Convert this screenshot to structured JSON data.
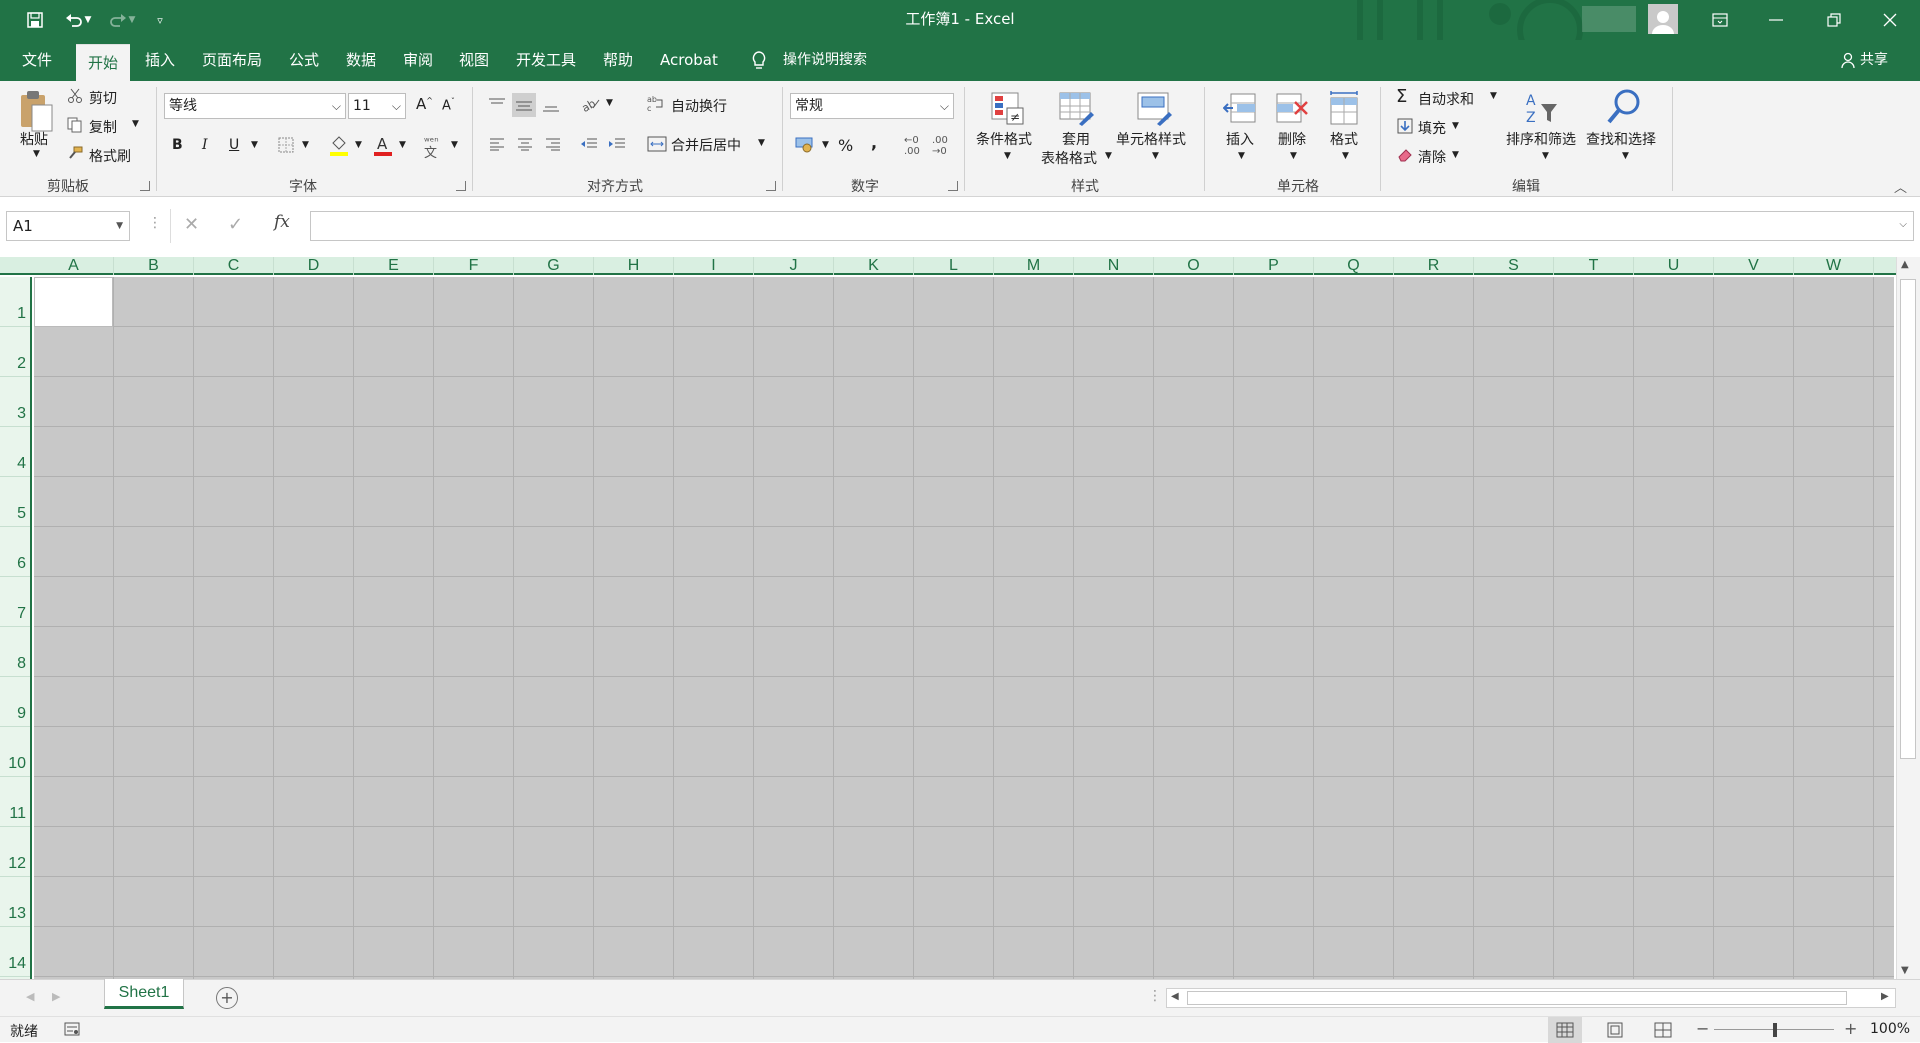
{
  "window": {
    "title": "工作簿1  -  Excel",
    "accent": "#217346"
  },
  "menu": {
    "items": [
      "文件",
      "开始",
      "插入",
      "页面布局",
      "公式",
      "数据",
      "审阅",
      "视图",
      "开发工具",
      "帮助",
      "Acrobat"
    ],
    "active": "开始",
    "tell_me": "操作说明搜索",
    "share": "共享"
  },
  "ribbon": {
    "clipboard": {
      "label": "剪贴板",
      "paste": "粘贴",
      "cut": "剪切",
      "copy": "复制",
      "format_painter": "格式刷"
    },
    "font": {
      "label": "字体",
      "font_name": "等线",
      "font_size": "11",
      "bold": "B",
      "italic": "I",
      "underline": "U"
    },
    "alignment": {
      "label": "对齐方式",
      "wrap_text": "自动换行",
      "merge_center": "合并后居中"
    },
    "number": {
      "label": "数字",
      "format": "常规",
      "percent": "%",
      "comma": ","
    },
    "styles": {
      "label": "样式",
      "conditional": "条件格式",
      "table_format_1": "套用",
      "table_format_2": "表格格式",
      "cell_styles": "单元格样式"
    },
    "cells": {
      "label": "单元格",
      "insert": "插入",
      "delete": "删除",
      "format": "格式"
    },
    "editing": {
      "label": "编辑",
      "autosum": "自动求和",
      "fill": "填充",
      "clear": "清除",
      "sort_filter": "排序和筛选",
      "find_select": "查找和选择"
    }
  },
  "formula_bar": {
    "name_box": "A1",
    "fx": "fx",
    "value": ""
  },
  "sheet": {
    "columns": [
      "A",
      "B",
      "C",
      "D",
      "E",
      "F",
      "G",
      "H",
      "I",
      "J",
      "K",
      "L",
      "M",
      "N",
      "O",
      "P",
      "Q",
      "R",
      "S",
      "T",
      "U",
      "V",
      "W"
    ],
    "rows": [
      "1",
      "2",
      "3",
      "4",
      "5",
      "6",
      "7",
      "8",
      "9",
      "10",
      "11",
      "12",
      "13",
      "14"
    ]
  },
  "tabs": {
    "sheets": [
      "Sheet1"
    ]
  },
  "status": {
    "ready": "就绪",
    "zoom": "100%"
  }
}
